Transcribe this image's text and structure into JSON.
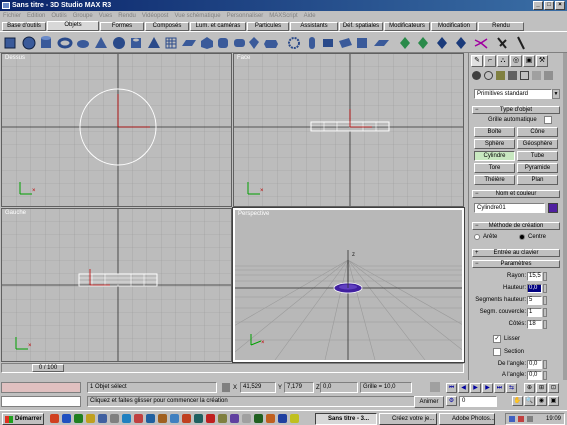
{
  "app": {
    "title": "Sans titre - 3D Studio MAX R3"
  },
  "menu": [
    "Fichier",
    "Edition",
    "Outils",
    "Groupe",
    "Vues",
    "Rendu",
    "Vidéopost",
    "Vue schématique",
    "Personnaliser",
    "MAXScript",
    "Aide"
  ],
  "tabs": [
    "Base d'outils",
    "Objets",
    "Formes",
    "Composés",
    "Lum. et caméras",
    "Particules",
    "Assistants",
    "Déf. spatiales",
    "Modificateurs",
    "Modification",
    "Rendu"
  ],
  "active_tab": "Objets",
  "viewports": {
    "top": "Dessus",
    "front": "Face",
    "left": "Gauche",
    "persp": "Perspective"
  },
  "panel": {
    "category": "Primitives standard",
    "object_type_header": "Type d'objet",
    "autogrid_label": "Grille automatique",
    "buttons": [
      "Boîte",
      "Cône",
      "Sphère",
      "Géosphère",
      "Cylindre",
      "Tube",
      "Tore",
      "Pyramide",
      "Théière",
      "Plan"
    ],
    "active_button": "Cylindre",
    "name_color_header": "Nom et couleur",
    "object_name": "Cylindre01",
    "object_color": "#5020a0",
    "creation_header": "Méthode de création",
    "creation_edge": "Arête",
    "creation_center": "Centre",
    "keyboard_header": "Entrée au clavier",
    "params_header": "Paramètres",
    "params": [
      {
        "label": "Rayon:",
        "value": "15,5"
      },
      {
        "label": "Hauteur:",
        "value": "0,0"
      },
      {
        "label": "Segments hauteur:",
        "value": "5"
      },
      {
        "label": "Segm. couvercle:",
        "value": "1"
      },
      {
        "label": "Côtés:",
        "value": "18"
      }
    ],
    "smooth_label": "Lisser",
    "slice_label": "Section",
    "slice_from_label": "De l'angle:",
    "slice_from_value": "0,0",
    "slice_to_label": "A l'angle:",
    "slice_to_value": "0,0"
  },
  "status": {
    "timeslider": "0 / 100",
    "selection": "1 Objet sélect",
    "prompt": "Cliquez et faites glisser pour commencer la création",
    "x": "41,529",
    "y": "7,179",
    "z": "0,0",
    "grid": "Grille = 10,0",
    "animate": "Animer",
    "frame": "0"
  },
  "taskbar": {
    "start": "Démarrer",
    "tasks": [
      "Sans titre - 3...",
      "Créez votre je...",
      "Adobe Photos..."
    ],
    "clock": "19:09"
  }
}
